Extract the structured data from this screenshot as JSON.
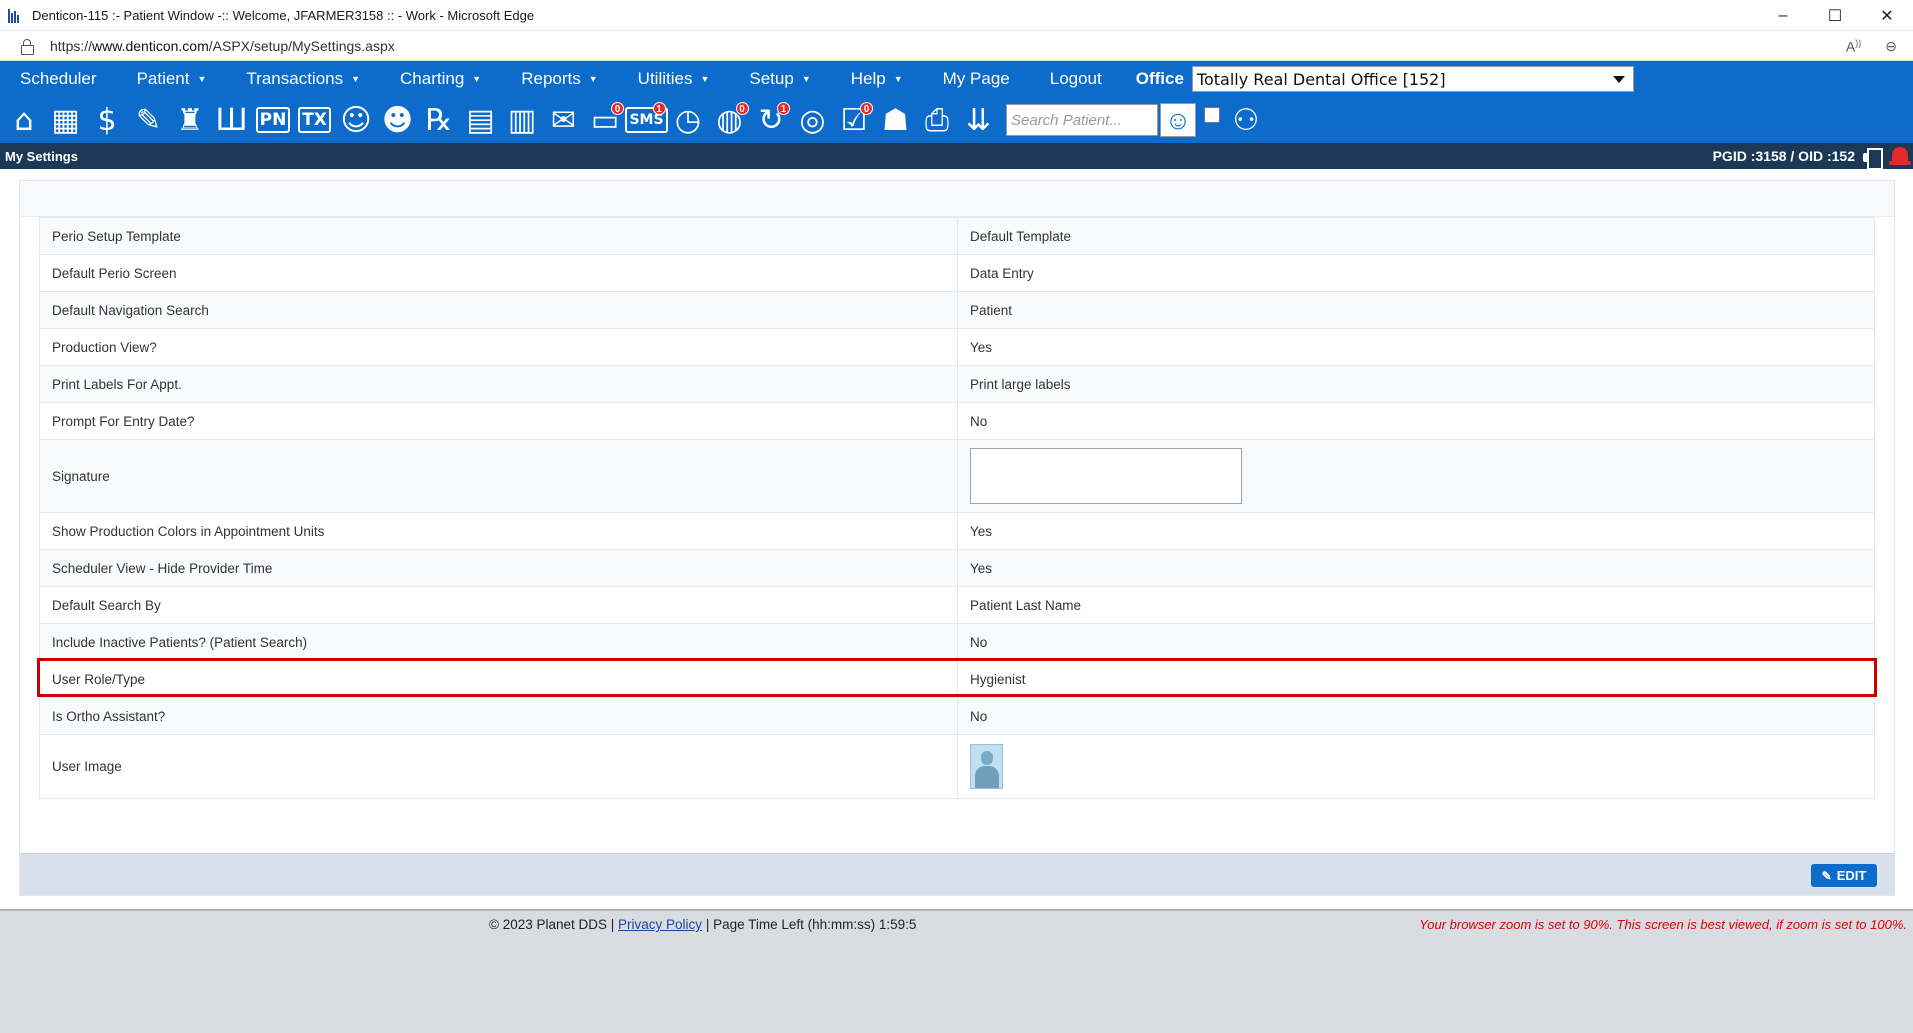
{
  "browser": {
    "title": "Denticon-115 :- Patient Window -:: Welcome, JFARMER3158 :: - Work - Microsoft Edge",
    "url_prefix": "https://",
    "url_host": "www.denticon.com",
    "url_path": "/ASPX/setup/MySettings.aspx",
    "minimize": "–",
    "maximize": "☐",
    "close": "✕"
  },
  "menu": {
    "items": [
      {
        "label": "Scheduler",
        "caret": ""
      },
      {
        "label": "Patient",
        "caret": "▼"
      },
      {
        "label": "Transactions",
        "caret": "▼"
      },
      {
        "label": "Charting",
        "caret": "▼"
      },
      {
        "label": "Reports",
        "caret": "▼"
      },
      {
        "label": "Utilities",
        "caret": "▼"
      },
      {
        "label": "Setup",
        "caret": "▼"
      },
      {
        "label": "Help",
        "caret": "▼"
      },
      {
        "label": "My Page",
        "caret": ""
      },
      {
        "label": "Logout",
        "caret": ""
      }
    ],
    "office_label": "Office",
    "office_value": "Totally Real Dental Office [152]"
  },
  "toolbar": {
    "search_placeholder": "Search Patient...",
    "badges": {
      "messages": "0",
      "sms": "1",
      "clock_alert": "0",
      "sync": "1",
      "tasks": "0"
    },
    "text_icons": {
      "pn": "PN",
      "tx": "TX",
      "sms": "SMS"
    }
  },
  "subheader": {
    "title": "My Settings",
    "pgid_oid": "PGID :3158  /  OID :152"
  },
  "settings": {
    "rows": [
      {
        "label": "Perio Setup Template",
        "value": "Default Template"
      },
      {
        "label": "Default Perio Screen",
        "value": "Data Entry"
      },
      {
        "label": "Default Navigation Search",
        "value": "Patient"
      },
      {
        "label": "Production View?",
        "value": "Yes"
      },
      {
        "label": "Print Labels For Appt.",
        "value": "Print large labels"
      },
      {
        "label": "Prompt For Entry Date?",
        "value": "No"
      },
      {
        "label": "Signature",
        "value": ""
      },
      {
        "label": "Show Production Colors in Appointment Units",
        "value": "Yes"
      },
      {
        "label": "Scheduler View - Hide Provider Time",
        "value": "Yes"
      },
      {
        "label": "Default Search By",
        "value": "Patient Last Name"
      },
      {
        "label": "Include Inactive Patients? (Patient Search)",
        "value": "No"
      },
      {
        "label": "User Role/Type",
        "value": "Hygienist"
      },
      {
        "label": "Is Ortho Assistant?",
        "value": "No"
      },
      {
        "label": "User Image",
        "value": ""
      }
    ],
    "edit_label": "EDIT"
  },
  "footer": {
    "copyright": "© 2023 Planet DDS",
    "sep1": " | ",
    "privacy": "Privacy Policy",
    "sep2": " |  ",
    "page_time": "Page Time Left (hh:mm:ss) 1:59:5",
    "zoom_warning": "Your browser zoom is set to 90%. This screen is best viewed, if zoom is set to 100%."
  },
  "colors": {
    "nav_blue": "#0c6bcb",
    "subheader_navy": "#1b3956",
    "highlight_red": "#cc0000",
    "warning_red": "#e00000"
  }
}
